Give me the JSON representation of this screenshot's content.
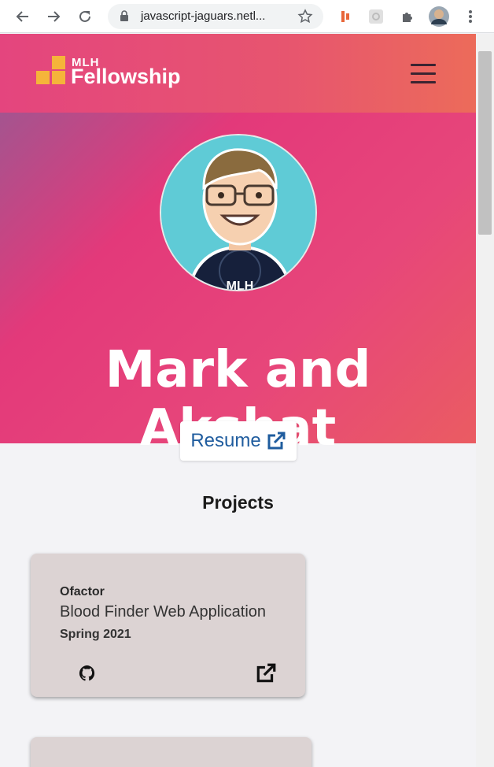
{
  "browser": {
    "url": "javascript-jaguars.netl...",
    "icons": [
      "back-icon",
      "forward-icon",
      "reload-icon",
      "lock-icon",
      "star-icon",
      "extension-icon",
      "puzzle-icon",
      "profile-avatar-icon",
      "menu-dots-icon"
    ]
  },
  "nav": {
    "logo_small": "MLH",
    "logo_text": "Fellowship",
    "menu_icon": "hamburger-icon"
  },
  "hero": {
    "name": "Mark and Akshat",
    "resume_label": "Resume",
    "colors": {
      "start": "#a4548f",
      "mid": "#e3397a",
      "end": "#ea5c62"
    }
  },
  "projects": {
    "title": "Projects",
    "items": [
      {
        "org": "Ofactor",
        "name": "Blood Finder Web Application",
        "term": "Spring 2021"
      },
      {
        "org": "",
        "name": "",
        "term": ""
      }
    ]
  }
}
